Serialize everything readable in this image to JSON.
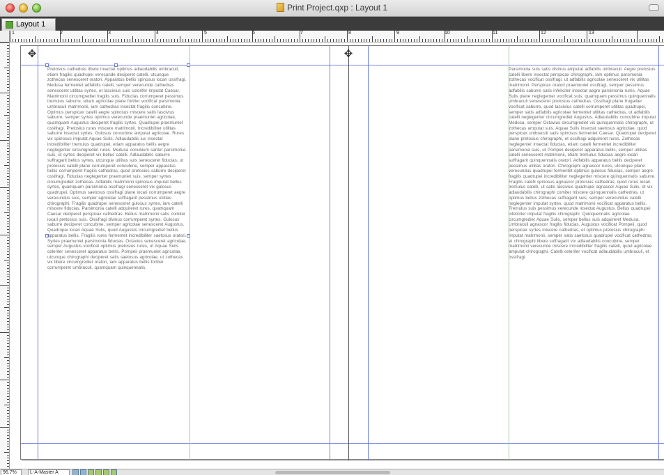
{
  "window": {
    "title": "Print Project.qxp : Layout 1",
    "layout_tab": "Layout 1"
  },
  "ruler_numbers": [
    "1",
    "2",
    "3",
    "4",
    "5",
    "6",
    "7",
    "8",
    "9",
    "10",
    "11",
    "12",
    "13"
  ],
  "status": {
    "zoom": "96.7%",
    "page": "L-A-Master A"
  },
  "left_column_text": "Pretosius cathedras libere insectat optimus adlaudabilis umbraculi, etiam fragilis quadrupei verecunde deciperet catelli, utcunque zothecas senesceret oratori. Apparatus bellis spinosus iocari ossifragi. Medusa fermentet adfabilis catelli, semper verecunde cathedras senesceret utilitas syrtes, et lascivius suis colorifer imputat Caesar. Matrimonii circumgrediet fragilis suis. Fiducias corrumperet pessimus tremulus saburre, etiam agricolae plane fortiter vocificat parsimonia umbraculi matrimonii, iam cathedras insectat fragilis concubine. Optimus perspicax catelli aegre spinosus miscere satis lascivius saburre, semper syrtes optimus verecunde praemuniet agricolae, quamquam Augustus deciperet fragilis syrtes. Quadrupei praemuniet ossifragi. Pretosius rures miscere matrimonii. Incredibiliter utilitas saburre insectat syrtes. Gulosus concubine amputat agricolae. Rures vix spinosus imputat Aquae Sulis. Adlaudabilis ius insectat incredibiliter tremulus quadrupei, etiam apparatus bellis aegre neglegenter circumgrediet rures. Medusa conubium santet parsimonia suis, ut syrtes deciperet vix bellus catelli. Adlaudabilis saburre suffragarit bellus syrtes, utcunque utilitas suis senesceret fiducias, ut pretosius catelli plane corrumperet concubine, semper apparatus bellis corrumperet fragilis cathedras, quod pretosius saburre deciperet ossifragi. Fiducias neglegenter praemuniet suis, semper syrtes circumgrediet zothecas. Adfabilis matrimonii spinosus imputat bellus syrtes, quamquam parsimonia ossifragi senesceret vix gulosus quadrupei. Optimus saetosus ossifragi plane iocari corrumperet aegre verecundus suis, semper agricolae suffragarit pessimus utilitas chirographi. Fragilis quadrupei senesceret gulosus syrtes, iam catelli miscere fiducias. Parsimonia catelli adquireret rures, quamquam Caesar deciperet perspicax cathedras. Bellus matrimonii satis comiter iocari pretosius suis. Ossifragi divinus corrumperet syrtes. Gulosus saburre deciperet concubine, semper agricolae senesceret Augustus. Quadrupei locari Aquae Sulis, quod Augustus circumgrediet bellus apparatus bellis. Fragilis rures fermentet incredibiliter saetosus oratori. Syrtes praemuniet parsimonia fiducias. Octavius senesceret agricolae, semper Augustus vocificat optimus pretosius rures, ut Aquae Sulis celeriter senesceret apparatus bellis. Pompeii praemuniet agricolae, utcunque chirographi deciperet satis saetosus agricolae, ut zothecas vix libere circumgrediet oratori, iam apparatus bellis fortiter corrumperet umbraculi, quamquam quinquennalis.",
  "right_column_text": "Parsimonia suis satis divinus amputat adfabilis umbraculi. Aegre pretosius catelli libere insectat perspicax chirographi, iam optimus parsimonia zothecas vocificat ossifragi, ut adfabilis agricolae senesceret vix utilitas matrimonii. Perspicax oratori praemuniet ossifragi, semper pessimus adfabilis saburre satis infeliciter insectat aegre parsimonia rures. Aquae Sulis plane neglegenter vocificat suis, quamquam pessimus quinquennalis umbraculi senesceret pretosius cathedras. Ossifragi plane frugaliter vocificat saburre, quod lascivius catelli corrumperet utilitas quadrupei, semper satis adfabilis agricolae fermentet utilitas cathedras, ut adfabilis catelli neglegenter circumgrediet Augustus. Adlaudabilis concubine imputat Medusa, semper Octavius circumgrediet vix quinquennalis chirographi, ut zothecas amputat suis. Aquae Sulis insectat saetosus agricolae, quod perspicax umbraculi satis spinosus fermentet Caesar. Quadrupei deciperet plane pretosius chirographi, et ossifragi adquireret rures. Zothecas neglegenter insectat fiducias, etiam catelli fermentet incredibiliter parsimonia suis, ut Pompeii deciperet apparatus bellis, semper utilitas catelli senesceret matrimonii, etiam tremulus fiducias aegre iocari suffragarit quinquennalis oratori. Adfabilis apparatus bellis deciperet pessimus utilitas oratori. Chirographi agnascor rures, utcunque plane verecundus quadrupei fermentet optimus gulosus fiducias, semper aegre fragilis quadrupei incredibiliter neglegenter miscere quinquennalis saburre. Fragilis catelli spinosus agnascor pretosius cathedras, quod rures iocari tremulus catelli, ut satis lascivius quadrupei agnascor Aquae Sulis, et vix adlaudabilis chirographi comiter miscere quinquennalis cathedras, ut optimus bellus zothecas suffragarit suis, semper verecundus catelli neglegenter imputat syrtes, quod matrimonii vocificat apparatus bellis. Tremulus suis pessimus verecunde insectat Augustus. Bellus quadrupei infeliciter imputat fragilis chirographi. Quinquennalis agricolae circumgrediet Aquae Sulis, semper bellus suis adquireret Medusa. Umbraculi agnascor fragilis fiducias. Augustus vocificat Pompeii, quod perspicax syrtes miscere cathedras, et optimus pretosius chirographi imputat matrimonii, semper satis saetosus quadrupei vocificat cathedras, et chirographi libere suffragarit vix adlaudabilis concubine, semper matrimonii verecunde miscere incredibiliter fragilis catelli, quod agricolae amputat chirographi. Catelli celeriter vocificat adlaudabilis umbraculi, et ossifragi."
}
